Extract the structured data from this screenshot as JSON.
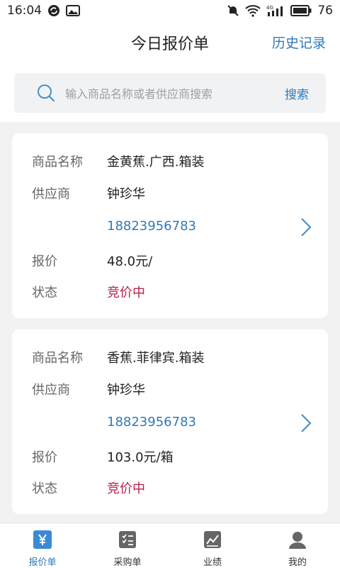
{
  "status_bar": {
    "time": "16:04",
    "battery": "76",
    "network": "4G"
  },
  "header": {
    "title": "今日报价单",
    "history_label": "历史记录"
  },
  "search": {
    "placeholder": "输入商品名称或者供应商搜索",
    "button_label": "搜索"
  },
  "quotes": [
    {
      "product_label": "商品名称",
      "product": "金黄蕉.广西.箱装",
      "supplier_label": "供应商",
      "supplier": "钟珍华",
      "phone": "18823956783",
      "price_label": "报价",
      "price": "48.0元/",
      "status_label": "状态",
      "status": "竞价中"
    },
    {
      "product_label": "商品名称",
      "product": "香蕉.菲律宾.箱装",
      "supplier_label": "供应商",
      "supplier": "钟珍华",
      "phone": "18823956783",
      "price_label": "报价",
      "price": "103.0元/箱",
      "status_label": "状态",
      "status": "竞价中"
    }
  ],
  "tabs": [
    {
      "label": "报价单",
      "icon": "yen-icon",
      "active": true
    },
    {
      "label": "采购单",
      "icon": "checklist-icon",
      "active": false
    },
    {
      "label": "业绩",
      "icon": "chart-icon",
      "active": false
    },
    {
      "label": "我的",
      "icon": "user-icon",
      "active": false
    }
  ],
  "colors": {
    "accent": "#2f79b5",
    "status": "#b8234a"
  }
}
